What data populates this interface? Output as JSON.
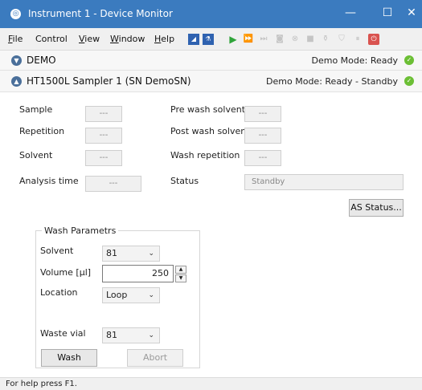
{
  "window": {
    "title": "Instrument 1 - Device Monitor"
  },
  "menu": [
    {
      "label": "File",
      "u": "F",
      "rest": "ile"
    },
    {
      "label": "Control",
      "u": "",
      "rest": "Control"
    },
    {
      "label": "View",
      "u": "V",
      "rest": "iew"
    },
    {
      "label": "Window",
      "u": "W",
      "rest": "indow"
    },
    {
      "label": "Help",
      "u": "H",
      "rest": "elp"
    }
  ],
  "sections": {
    "demo": {
      "title": "DEMO",
      "status": "Demo Mode: Ready"
    },
    "sampler": {
      "title": "HT1500L Sampler 1 (SN DemoSN)",
      "status": "Demo Mode: Ready - Standby"
    }
  },
  "fields": {
    "sample": {
      "label": "Sample",
      "value": "---"
    },
    "repetition": {
      "label": "Repetition",
      "value": "---"
    },
    "solvent": {
      "label": "Solvent",
      "value": "---"
    },
    "analysis_time": {
      "label": "Analysis time",
      "value": "---"
    },
    "pre_wash": {
      "label": "Pre wash solvent",
      "value": "---"
    },
    "post_wash": {
      "label": "Post wash solvent",
      "value": "---"
    },
    "wash_rep": {
      "label": "Wash repetition",
      "value": "---"
    },
    "status": {
      "label": "Status",
      "value": "Standby"
    }
  },
  "as_status_button": "AS Status...",
  "wash": {
    "group_title": "Wash Parametrs",
    "solvent_label": "Solvent",
    "solvent_value": "81",
    "volume_label": "Volume [µl]",
    "volume_value": "250",
    "location_label": "Location",
    "location_value": "Loop",
    "waste_label": "Waste vial",
    "waste_value": "81",
    "wash_button": "Wash",
    "abort_button": "Abort"
  },
  "statusbar": {
    "text": "For help press F1."
  }
}
